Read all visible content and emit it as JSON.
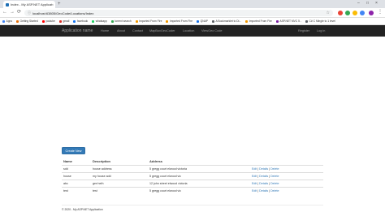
{
  "browser": {
    "tab_title": "Index - My ASP.NET Application",
    "tab_close": "×",
    "new_tab": "+",
    "url": "localhost:63805/GeoCode/Locations/Index",
    "back": "←",
    "forward": "→",
    "reload": "⟳",
    "star": "☆",
    "win_min": "–",
    "win_max": "□",
    "win_close": "×",
    "bookmarks": [
      {
        "label": "Apps",
        "color": "#4285f4"
      },
      {
        "label": "Getting Started",
        "color": "#e8710a"
      },
      {
        "label": "youtube",
        "color": "#ff0000"
      },
      {
        "label": "gmail",
        "color": "#d93025"
      },
      {
        "label": "facebook",
        "color": "#1877f2"
      },
      {
        "label": "whatsapp",
        "color": "#25d366"
      },
      {
        "label": "torrent search",
        "color": "#34a853"
      },
      {
        "label": "Imported From Fire",
        "color": "#f29900"
      },
      {
        "label": "Imported From Fire",
        "color": "#f29900"
      },
      {
        "label": "QNAP",
        "color": "#1a73e8"
      },
      {
        "label": "A Bookmarklet to Di...",
        "color": "#5f6368"
      },
      {
        "label": "Imported From Fire",
        "color": "#f29900"
      },
      {
        "label": "ASP.NET MVC 5 -",
        "color": "#7b1fa2"
      },
      {
        "label": "C# C Mingle to 1 level",
        "color": "#5f6368"
      }
    ]
  },
  "navbar": {
    "brand": "Application name",
    "links": [
      "Home",
      "About",
      "Contact",
      "MapBoxGeoCoder",
      "Location",
      "ViewGeo Code"
    ],
    "register": "Register",
    "login": "Log in"
  },
  "content": {
    "create_label": "Create New",
    "columns": [
      "Name",
      "Description",
      "Address",
      ""
    ],
    "rows": [
      {
        "name": "sdd",
        "description": "house address",
        "address": "5 gregg court elwood victoria"
      },
      {
        "name": "house",
        "description": "my house add",
        "address": "5 gregg court elwood vic"
      },
      {
        "name": "abc",
        "description": "gen'neih",
        "address": "12 john street elwood victoria"
      },
      {
        "name": "test",
        "description": "test",
        "address": "5 gregg court elwood vic"
      }
    ],
    "edit": "Edit",
    "details": "Details",
    "delete": "Delete",
    "sep": " | "
  },
  "footer": {
    "text": "© 2020 - My ASP.NET Application"
  }
}
